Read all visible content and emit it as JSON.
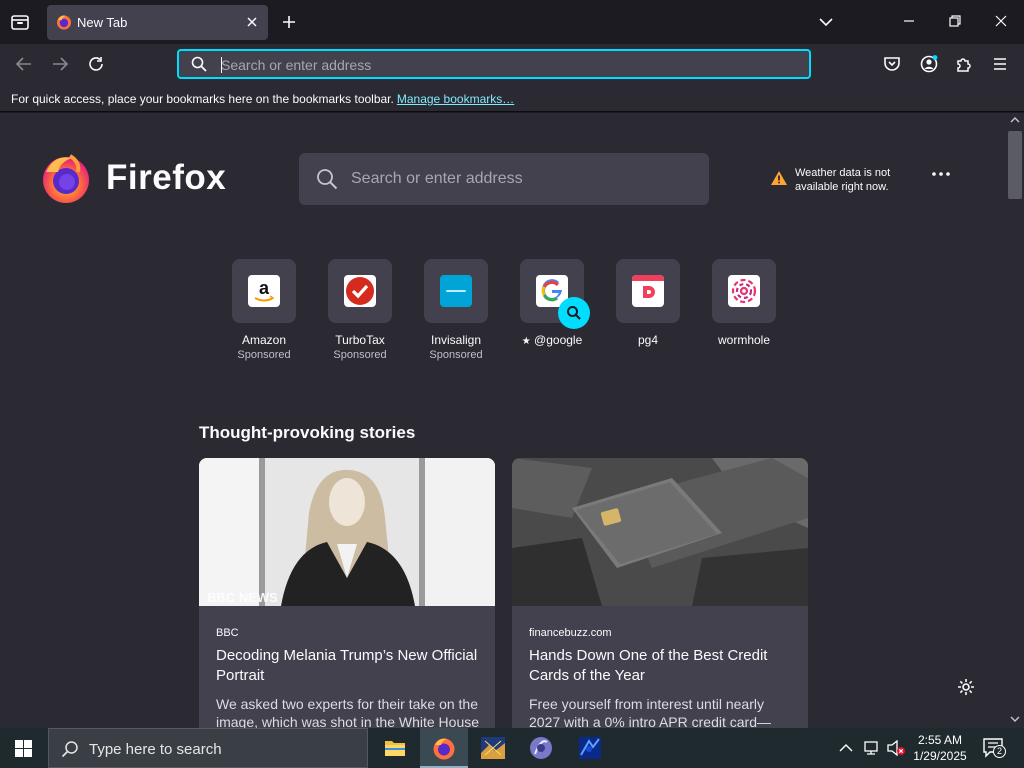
{
  "browser": {
    "tab": {
      "title": "New Tab"
    },
    "urlbar": {
      "placeholder": "Search or enter address",
      "value": ""
    },
    "bookmarks_bar": {
      "text": "For quick access, place your bookmarks here on the bookmarks toolbar.",
      "link": "Manage bookmarks…"
    },
    "colors": {
      "accent": "#00ddff",
      "background": "#2b2a33",
      "surface": "#42414d",
      "link": "#80ebff"
    }
  },
  "newtab": {
    "brand": "Firefox",
    "search": {
      "placeholder": "Search or enter address"
    },
    "weather": {
      "message": "Weather data is not available right now."
    },
    "shortcuts": [
      {
        "label": "Amazon",
        "sub": "Sponsored",
        "icon": "amazon-icon"
      },
      {
        "label": "TurboTax",
        "sub": "Sponsored",
        "icon": "turbotax-icon"
      },
      {
        "label": "Invisalign",
        "sub": "Sponsored",
        "icon": "invisalign-icon"
      },
      {
        "label": "@google",
        "sub": "",
        "icon": "google-icon"
      },
      {
        "label": "pg4",
        "sub": "",
        "icon": "pg4-icon"
      },
      {
        "label": "wormhole",
        "sub": "",
        "icon": "wormhole-icon"
      }
    ],
    "stories": {
      "heading": "Thought-provoking stories",
      "cards": [
        {
          "source": "BBC",
          "title": "Decoding Melania Trump’s New Official Portrait",
          "description": "We asked two experts for their take on the image, which was shot in the White House",
          "image_watermark": "BBC NEWS"
        },
        {
          "source": "financebuzz.com",
          "title": "Hands Down One of the Best Credit Cards of the Year",
          "description": "Free yourself from interest until nearly 2027 with a 0% intro APR credit card—"
        }
      ]
    }
  },
  "taskbar": {
    "search_placeholder": "Type here to search",
    "clock": {
      "time": "2:55 AM",
      "date": "1/29/2025"
    },
    "notification_count": "2"
  }
}
